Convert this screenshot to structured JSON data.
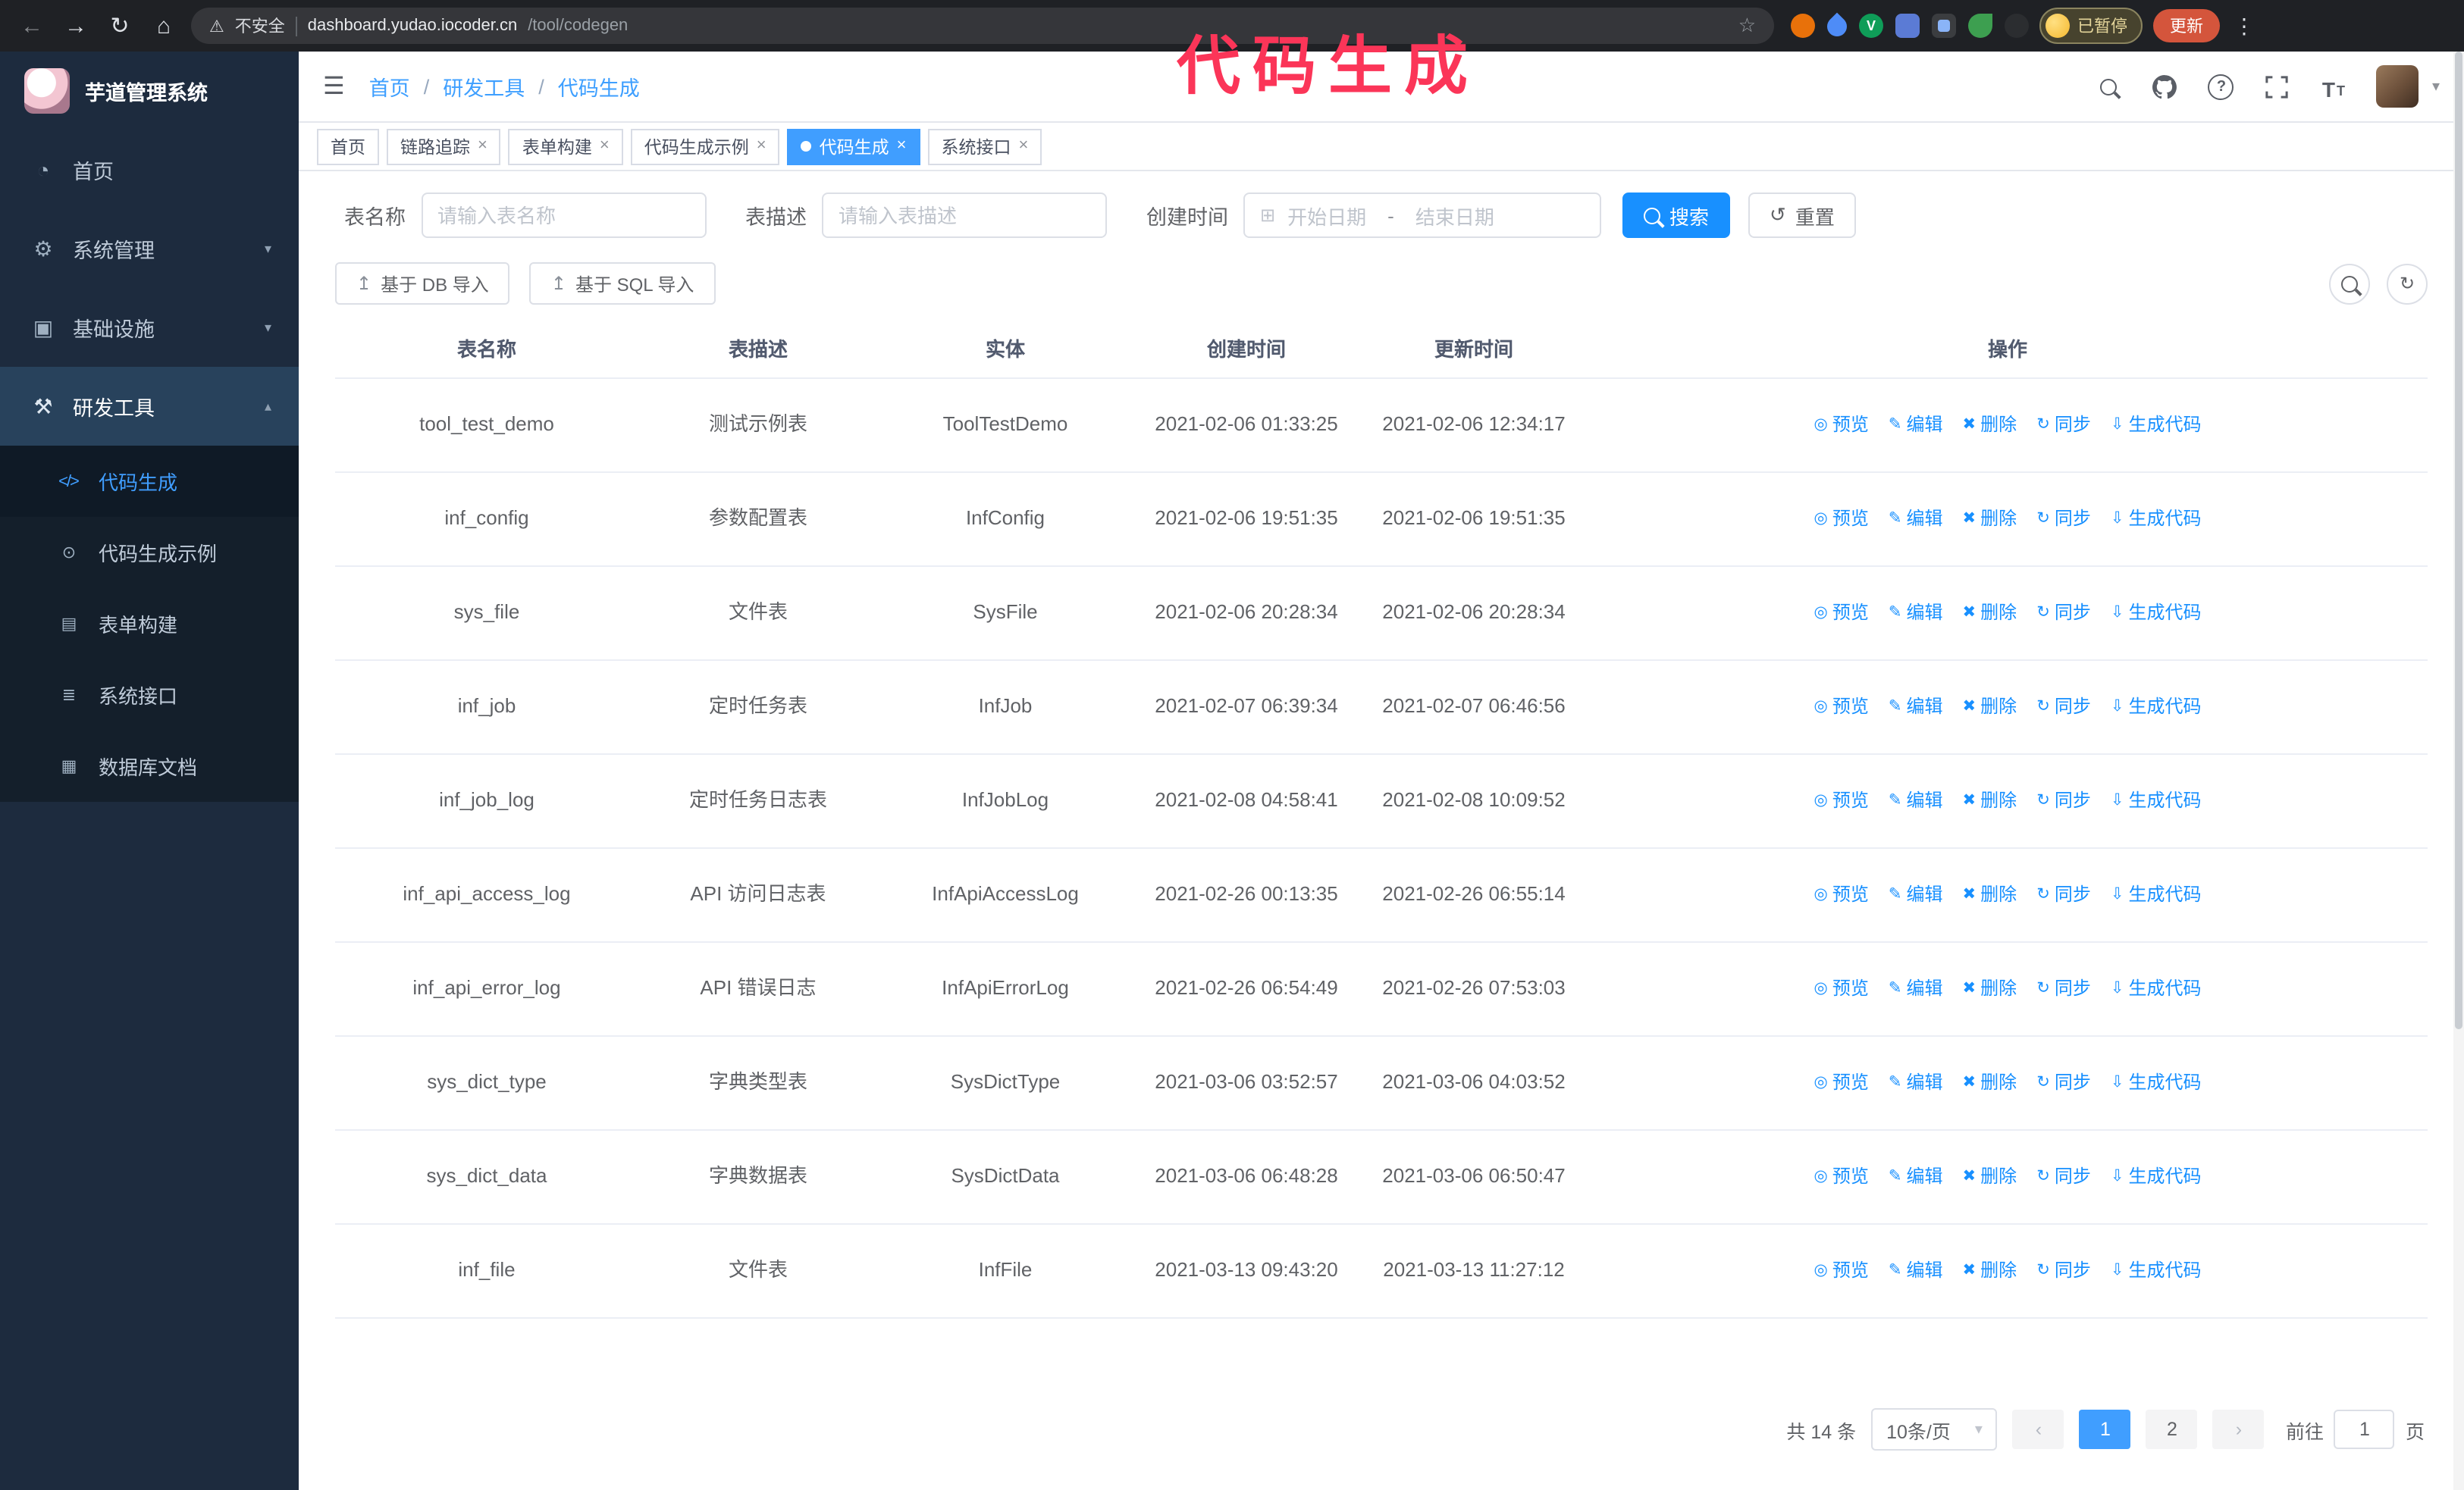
{
  "colors": {
    "primary": "#1890ff",
    "active_tab": "#409eff",
    "annotation": "#fb3558",
    "sidebar_bg": "#1d2b3e",
    "update_button_bg": "#d4553c"
  },
  "browser": {
    "security_warning": "不安全",
    "url_domain": "dashboard.yudao.iocoder.cn",
    "url_path": "/tool/codegen",
    "paused_badge": "已暂停",
    "update_button": "更新"
  },
  "annotation": {
    "text": "代码生成"
  },
  "sidebar": {
    "logo_title": "芋道管理系统",
    "items": [
      {
        "label": "首页"
      },
      {
        "label": "系统管理"
      },
      {
        "label": "基础设施"
      },
      {
        "label": "研发工具"
      }
    ],
    "submenu": [
      {
        "label": "代码生成"
      },
      {
        "label": "代码生成示例"
      },
      {
        "label": "表单构建"
      },
      {
        "label": "系统接口"
      },
      {
        "label": "数据库文档"
      }
    ]
  },
  "header": {
    "breadcrumb": [
      "首页",
      "研发工具",
      "代码生成"
    ],
    "separator": "/"
  },
  "tabs": [
    {
      "label": "首页"
    },
    {
      "label": "链路追踪"
    },
    {
      "label": "表单构建"
    },
    {
      "label": "代码生成示例"
    },
    {
      "label": "代码生成"
    },
    {
      "label": "系统接口"
    }
  ],
  "filters": {
    "table_name_label": "表名称",
    "table_name_placeholder": "请输入表名称",
    "table_desc_label": "表描述",
    "table_desc_placeholder": "请输入表描述",
    "create_time_label": "创建时间",
    "date_start_placeholder": "开始日期",
    "date_separator": "-",
    "date_end_placeholder": "结束日期",
    "search_button": "搜索",
    "reset_button": "重置"
  },
  "toolbar": {
    "import_db_button": "基于 DB 导入",
    "import_sql_button": "基于 SQL 导入"
  },
  "table": {
    "columns": [
      "表名称",
      "表描述",
      "实体",
      "创建时间",
      "更新时间",
      "操作"
    ],
    "actions": [
      "预览",
      "编辑",
      "删除",
      "同步",
      "生成代码"
    ],
    "rows": [
      {
        "name": "tool_test_demo",
        "desc": "测试示例表",
        "entity": "ToolTestDemo",
        "created": "2021-02-06 01:33:25",
        "updated": "2021-02-06 12:34:17"
      },
      {
        "name": "inf_config",
        "desc": "参数配置表",
        "entity": "InfConfig",
        "created": "2021-02-06 19:51:35",
        "updated": "2021-02-06 19:51:35"
      },
      {
        "name": "sys_file",
        "desc": "文件表",
        "entity": "SysFile",
        "created": "2021-02-06 20:28:34",
        "updated": "2021-02-06 20:28:34"
      },
      {
        "name": "inf_job",
        "desc": "定时任务表",
        "entity": "InfJob",
        "created": "2021-02-07 06:39:34",
        "updated": "2021-02-07 06:46:56"
      },
      {
        "name": "inf_job_log",
        "desc": "定时任务日志表",
        "entity": "InfJobLog",
        "created": "2021-02-08 04:58:41",
        "updated": "2021-02-08 10:09:52"
      },
      {
        "name": "inf_api_access_log",
        "desc": "API 访问日志表",
        "entity": "InfApiAccessLog",
        "created": "2021-02-26 00:13:35",
        "updated": "2021-02-26 06:55:14"
      },
      {
        "name": "inf_api_error_log",
        "desc": "API 错误日志",
        "entity": "InfApiErrorLog",
        "created": "2021-02-26 06:54:49",
        "updated": "2021-02-26 07:53:03"
      },
      {
        "name": "sys_dict_type",
        "desc": "字典类型表",
        "entity": "SysDictType",
        "created": "2021-03-06 03:52:57",
        "updated": "2021-03-06 04:03:52"
      },
      {
        "name": "sys_dict_data",
        "desc": "字典数据表",
        "entity": "SysDictData",
        "created": "2021-03-06 06:48:28",
        "updated": "2021-03-06 06:50:47"
      },
      {
        "name": "inf_file",
        "desc": "文件表",
        "entity": "InfFile",
        "created": "2021-03-13 09:43:20",
        "updated": "2021-03-13 11:27:12"
      }
    ]
  },
  "pagination": {
    "total": "共 14 条",
    "page_size": "10条/页",
    "prev": "‹",
    "next": "›",
    "pages": [
      "1",
      "2"
    ],
    "goto_label": "前往",
    "goto_value": "1",
    "goto_suffix": "页"
  },
  "icons": {
    "back": "←",
    "forward": "→",
    "reload": "↻",
    "home": "⌂",
    "warning": "⚠",
    "star": "☆",
    "overflow": "⋮",
    "hamburger": "☰",
    "question": "?",
    "fontsize": "T",
    "caret_down": "▾",
    "chevron_down": "▾",
    "chevron_up": "▴",
    "menu_home": "◔",
    "menu_system": "⚙",
    "menu_infra": "▣",
    "menu_tools": "⚒",
    "sub_code": "</>",
    "sub_example": "⊙",
    "sub_form": "▤",
    "sub_api": "≣",
    "sub_db": "▦",
    "calendar": "⊞",
    "reset": "↺",
    "import": "↥",
    "refresh": "↻",
    "eye": "◎",
    "edit": "✎",
    "trash": "✖",
    "sync": "↻",
    "download": "⇩",
    "close": "×",
    "ext_v": "V"
  }
}
